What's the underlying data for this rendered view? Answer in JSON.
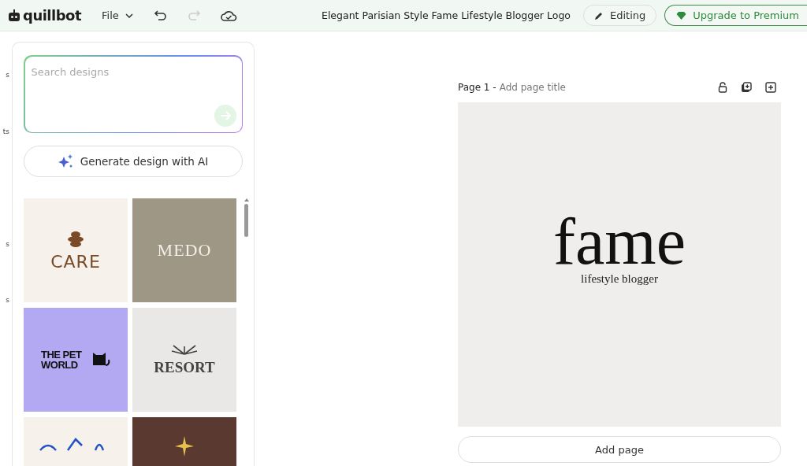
{
  "topbar": {
    "brand": "quillbot",
    "file_menu": "File",
    "document_title": "Elegant Parisian Style Fame Lifestyle Blogger Logo",
    "editing_button": "Editing",
    "upgrade_button": "Upgrade to Premium"
  },
  "sidebar_fragments": [
    "s",
    "ts",
    "s",
    "s"
  ],
  "panel": {
    "search": {
      "placeholder": "Search designs"
    },
    "generate_button": "Generate design with AI",
    "templates": [
      {
        "kind": "care",
        "title": "CARE",
        "color": "#f6f1ea"
      },
      {
        "kind": "medo",
        "title": "MEDO",
        "color": "#9e9786"
      },
      {
        "kind": "pet",
        "title": "THE PET WORLD",
        "color": "#b2a9f2"
      },
      {
        "kind": "resort",
        "title": "RESORT",
        "color": "#e9e8e7"
      },
      {
        "kind": "floral",
        "color": "#f6f1ea"
      },
      {
        "kind": "star",
        "color": "#5a3a30"
      }
    ]
  },
  "page": {
    "label": "Page 1 -",
    "title_placeholder": "Add page title",
    "logo_word": "fame",
    "logo_tagline": "lifestyle blogger",
    "add_page_button": "Add page"
  }
}
